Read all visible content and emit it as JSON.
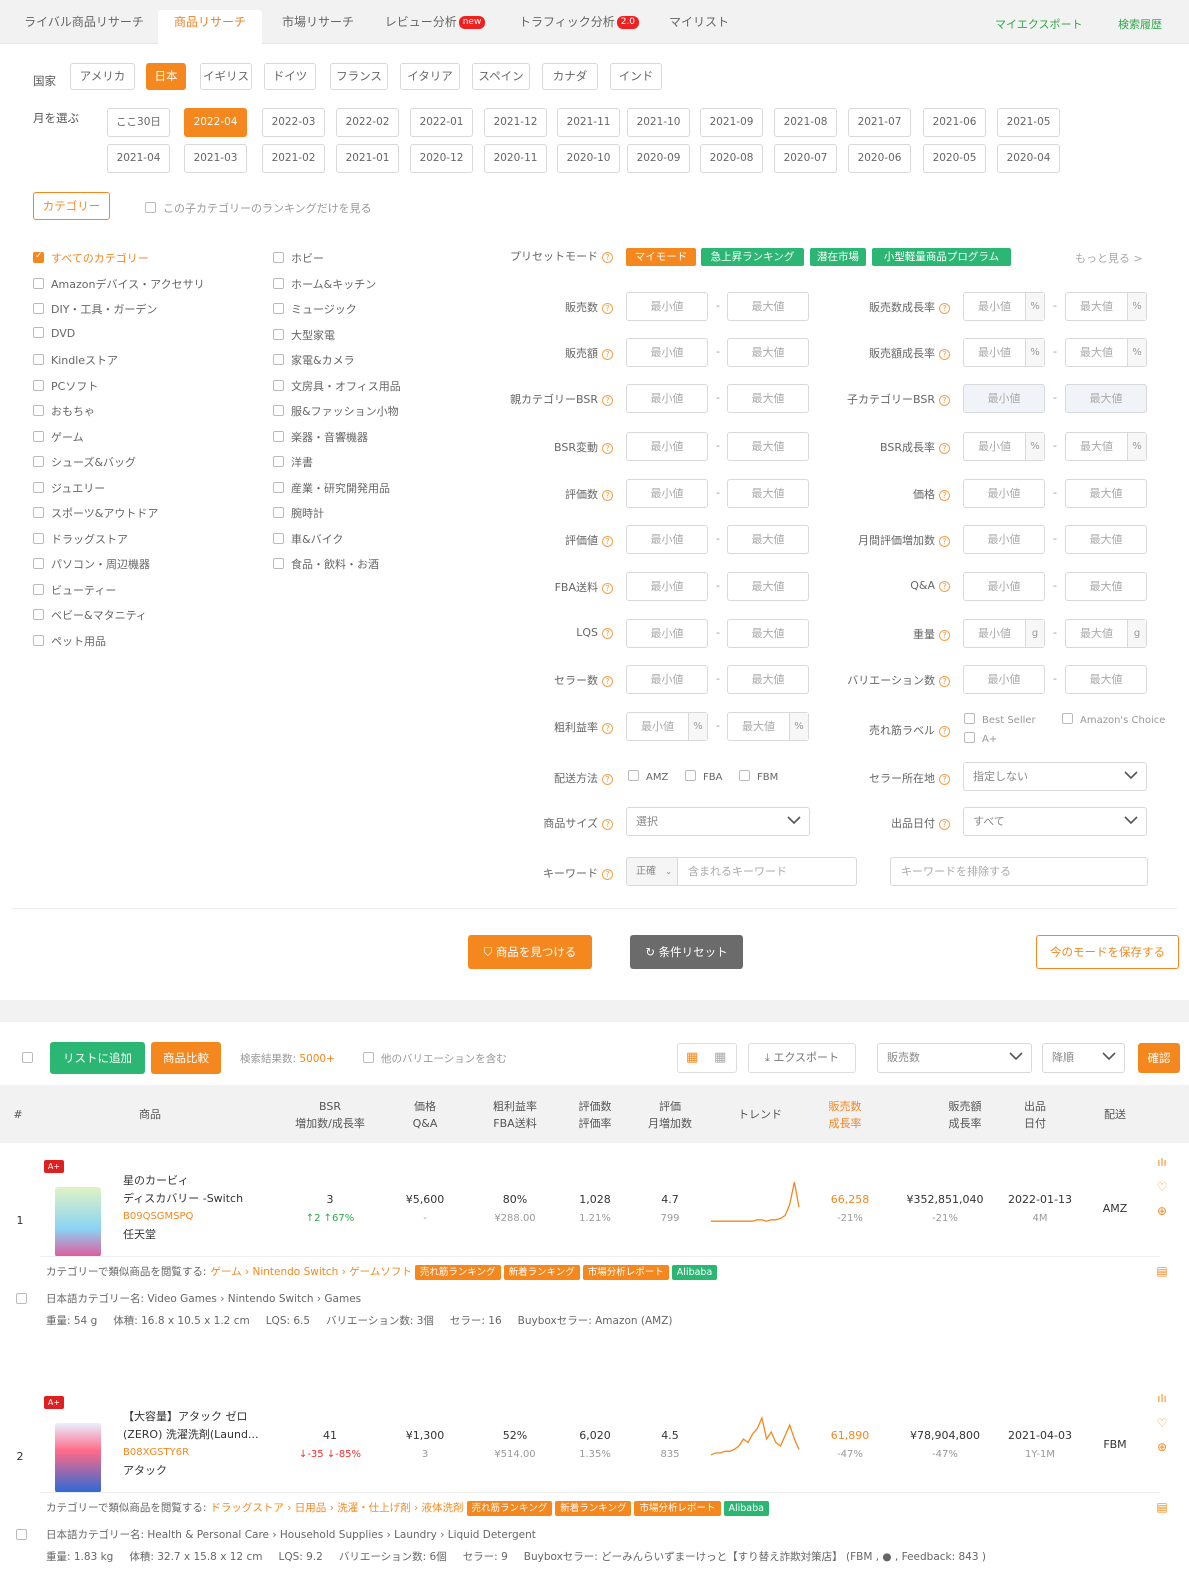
{
  "tabs": [
    {
      "label": "ライバル商品リサーチ",
      "badge": ""
    },
    {
      "label": "商品リサーチ",
      "badge": ""
    },
    {
      "label": "市場リサーチ",
      "badge": ""
    },
    {
      "label": "レビュー分析",
      "badge": "new"
    },
    {
      "label": "トラフィック分析",
      "badge": "2.0"
    },
    {
      "label": "マイリスト",
      "badge": ""
    }
  ],
  "top_links": {
    "export": "マイエクスポート",
    "history": "検索履歴"
  },
  "country": {
    "label": "国家",
    "options": [
      "アメリカ",
      "日本",
      "イギリス",
      "ドイツ",
      "フランス",
      "イタリア",
      "スペイン",
      "カナダ",
      "インド"
    ],
    "selected": "日本"
  },
  "month": {
    "label": "月を選ぶ",
    "row1": [
      "ここ30日",
      "2022-04",
      "2022-03",
      "2022-02",
      "2022-01",
      "2021-12",
      "2021-11",
      "2021-10",
      "2021-09",
      "2021-08",
      "2021-07",
      "2021-06",
      "2021-05"
    ],
    "row2": [
      "2021-04",
      "2021-03",
      "2021-02",
      "2021-01",
      "2020-12",
      "2020-11",
      "2020-10",
      "2020-09",
      "2020-08",
      "2020-07",
      "2020-06",
      "2020-05",
      "2020-04"
    ],
    "selected": "2022-04"
  },
  "category": {
    "button": "カテゴリー",
    "only_child": "この子カテゴリーのランキングだけを見る",
    "col1": [
      "すべてのカテゴリー",
      "Amazonデバイス・アクセサリ",
      "DIY・工具・ガーデン",
      "DVD",
      "Kindleストア",
      "PCソフト",
      "おもちゃ",
      "ゲーム",
      "シューズ&バッグ",
      "ジュエリー",
      "スポーツ&アウトドア",
      "ドラッグストア",
      "パソコン・周辺機器",
      "ビューティー",
      "ベビー&マタニティ",
      "ペット用品"
    ],
    "col2": [
      "ホビー",
      "ホーム&キッチン",
      "ミュージック",
      "大型家電",
      "家電&カメラ",
      "文房具・オフィス用品",
      "服&ファッション小物",
      "楽器・音響機器",
      "洋書",
      "産業・研究開発用品",
      "腕時計",
      "車&バイク",
      "食品・飲料・お酒"
    ]
  },
  "preset": {
    "label": "プリセットモード",
    "tags": [
      {
        "label": "マイモード",
        "color": "#f5871f"
      },
      {
        "label": "急上昇ランキング",
        "color": "#2bb673"
      },
      {
        "label": "潜在市場",
        "color": "#2bb673"
      },
      {
        "label": "小型軽量商品プログラム",
        "color": "#2bb673"
      }
    ],
    "more": "もっと見る >"
  },
  "filters": {
    "min": "最小値",
    "max": "最大値",
    "left": [
      "販売数",
      "販売額",
      "親カテゴリーBSR",
      "BSR変動",
      "評価数",
      "評価値",
      "FBA送料",
      "LQS",
      "セラー数",
      "粗利益率"
    ],
    "right": [
      "販売数成長率",
      "販売額成長率",
      "子カテゴリーBSR",
      "BSR成長率",
      "価格",
      "月間評価増加数",
      "Q&A",
      "重量",
      "バリエーション数",
      "売れ筋ラベル"
    ],
    "percent": "%",
    "gram": "g",
    "labels_opts": [
      "Best Seller",
      "Amazon's Choice",
      "A+"
    ],
    "shipping_label": "配送方法",
    "shipping_opts": [
      "AMZ",
      "FBA",
      "FBM"
    ],
    "seller_loc_label": "セラー所在地",
    "seller_loc_value": "指定しない",
    "size_label": "商品サイズ",
    "size_value": "選択",
    "date_label": "出品日付",
    "date_value": "すべて",
    "keyword_label": "キーワード",
    "keyword_mode": "正確",
    "keyword_placeholder": "含まれるキーワード",
    "exclude_placeholder": "キーワードを排除する"
  },
  "actions": {
    "find": "商品を見つける",
    "reset": "条件リセット",
    "save": "今のモードを保存する"
  },
  "results": {
    "add_list": "リストに追加",
    "compare": "商品比較",
    "count_label": "検索結果数:",
    "count": "5000+",
    "include_var": "他のバリエーションを含む",
    "export": "エクスポート",
    "sort_field": "販売数",
    "sort_order": "降順",
    "confirm": "確認"
  },
  "table_headers": [
    {
      "l1": "#",
      "l2": ""
    },
    {
      "l1": "商品",
      "l2": ""
    },
    {
      "l1": "BSR",
      "l2": "増加数/成長率"
    },
    {
      "l1": "価格",
      "l2": "Q&A"
    },
    {
      "l1": "粗利益率",
      "l2": "FBA送料"
    },
    {
      "l1": "評価数",
      "l2": "評価率"
    },
    {
      "l1": "評価",
      "l2": "月増加数"
    },
    {
      "l1": "トレンド",
      "l2": ""
    },
    {
      "l1": "販売数",
      "l2": "成長率"
    },
    {
      "l1": "販売額",
      "l2": "成長率"
    },
    {
      "l1": "出品",
      "l2": "日付"
    },
    {
      "l1": "配送",
      "l2": ""
    }
  ],
  "products": [
    {
      "index": "1",
      "aplus": "A+",
      "name1": "星のカービィ",
      "name2": "ディスカバリー -Switch",
      "asin": "B09QSGMSPQ",
      "brand": "任天堂",
      "bsr": "3",
      "bsr_change": "↑2 ↑67%",
      "bsr_dir": "up",
      "price": "¥5,600",
      "qa": "-",
      "margin": "80%",
      "fba": "¥288.00",
      "reviews": "1,028",
      "review_rate": "1.21%",
      "rating": "4.7",
      "rating_inc": "799",
      "trend": [
        2,
        2,
        2,
        2,
        2,
        2,
        2,
        2,
        2,
        2,
        3,
        3,
        2,
        3,
        3,
        4,
        6,
        14,
        30,
        12
      ],
      "sales": "66,258",
      "sales_growth": "-21%",
      "revenue": "¥352,851,040",
      "revenue_growth": "-21%",
      "date": "2022-01-13",
      "date_sub": "4M",
      "ship": "AMZ",
      "cat_prefix": "カテゴリーで類似商品を閲覧する:",
      "cat_path": "ゲーム › Nintendo Switch › ゲームソフト",
      "jp_cat": "日本語カテゴリー名: Video Games › Nintendo Switch › Games",
      "weight": "重量: 54 g",
      "dims": "体積: 16.8 x 10.5 x 1.2 cm",
      "lqs": "LQS: 6.5",
      "variations": "バリエーション数: 3個",
      "sellers": "セラー: 16",
      "buybox": "Buyboxセラー: Amazon (AMZ)"
    },
    {
      "index": "2",
      "aplus": "A+",
      "name1": "【大容量】アタック ゼロ",
      "name2": "(ZERO) 洗濯洗剤(Laund...",
      "asin": "B08XGSTY6R",
      "brand": "アタック",
      "bsr": "41",
      "bsr_change": "↓-35 ↓-85%",
      "bsr_dir": "down",
      "price": "¥1,300",
      "qa": "3",
      "margin": "52%",
      "fba": "¥514.00",
      "reviews": "6,020",
      "review_rate": "1.35%",
      "rating": "4.5",
      "rating_inc": "835",
      "trend": [
        3,
        4,
        4,
        5,
        5,
        6,
        8,
        12,
        10,
        15,
        18,
        24,
        12,
        16,
        10,
        8,
        14,
        20,
        12,
        6
      ],
      "sales": "61,890",
      "sales_growth": "-47%",
      "revenue": "¥78,904,800",
      "revenue_growth": "-47%",
      "date": "2021-04-03",
      "date_sub": "1Y-1M",
      "ship": "FBM",
      "cat_prefix": "カテゴリーで類似商品を閲覧する:",
      "cat_path": "ドラッグストア › 日用品 › 洗濯・仕上げ剤 › 液体洗剤",
      "jp_cat": "日本語カテゴリー名: Health & Personal Care › Household Supplies › Laundry › Liquid Detergent",
      "weight": "重量: 1.83 kg",
      "dims": "体積: 32.7 x 15.8 x 12 cm",
      "lqs": "LQS: 9.2",
      "variations": "バリエーション数: 6個",
      "sellers": "セラー: 9",
      "buybox": "Buyboxセラー: どーみんらいずまーけっと【すり替え詐欺対策店】 (FBM , ● , Feedback: 843 )"
    }
  ],
  "row_tags": [
    {
      "label": "売れ筋ランキング",
      "color": "#f5871f"
    },
    {
      "label": "新着ランキング",
      "color": "#f5871f"
    },
    {
      "label": "市場分析レポート",
      "color": "#f5871f"
    },
    {
      "label": "Alibaba",
      "color": "#2bb673"
    }
  ],
  "colors": {
    "accent": "#f5871f",
    "green": "#2bb673",
    "gray_btn": "#6b6b6b"
  }
}
